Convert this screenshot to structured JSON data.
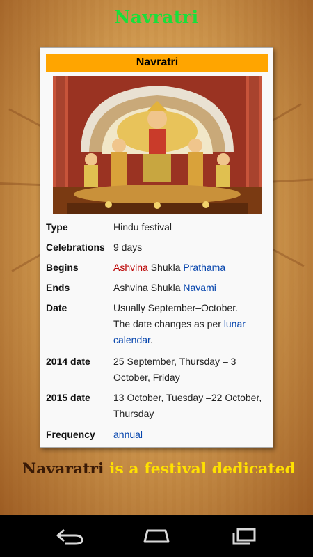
{
  "app": {
    "title": "Navratri"
  },
  "infobox": {
    "header": "Navratri",
    "image_alt": "Durga idol",
    "rows": {
      "type": {
        "label": "Type",
        "value": "Hindu festival"
      },
      "celebrations": {
        "label": "Celebrations",
        "value": "9 days"
      },
      "begins": {
        "label": "Begins",
        "v1": "Ashvina",
        "v2": " Shukla ",
        "v3": "Prathama"
      },
      "ends": {
        "label": "Ends",
        "v1": "Ashvina Shukla ",
        "v2": "Navami"
      },
      "date": {
        "label": "Date",
        "line1": "Usually September–October.",
        "v1": "The date changes as per ",
        "v2": "lunar calendar",
        "v3": "."
      },
      "date2014": {
        "label": "2014 date",
        "value": "25 September, Thursday – 3 October, Friday"
      },
      "date2015": {
        "label": "2015 date",
        "value": "13 October, Tuesday –22 October, Thursday"
      },
      "frequency": {
        "label": "Frequency",
        "value": "annual"
      }
    }
  },
  "marquee": {
    "word1": "Navaratri",
    "rest": " is a festival dedicated"
  },
  "navbar": {
    "back_icon": "back-icon",
    "home_icon": "home-icon",
    "recents_icon": "recent-apps-icon"
  },
  "colors": {
    "title_green": "#19e03a",
    "header_orange": "#ffa500",
    "link_blue": "#0645ad",
    "link_red": "#ba0000",
    "marquee_yellow": "#ffe100"
  }
}
